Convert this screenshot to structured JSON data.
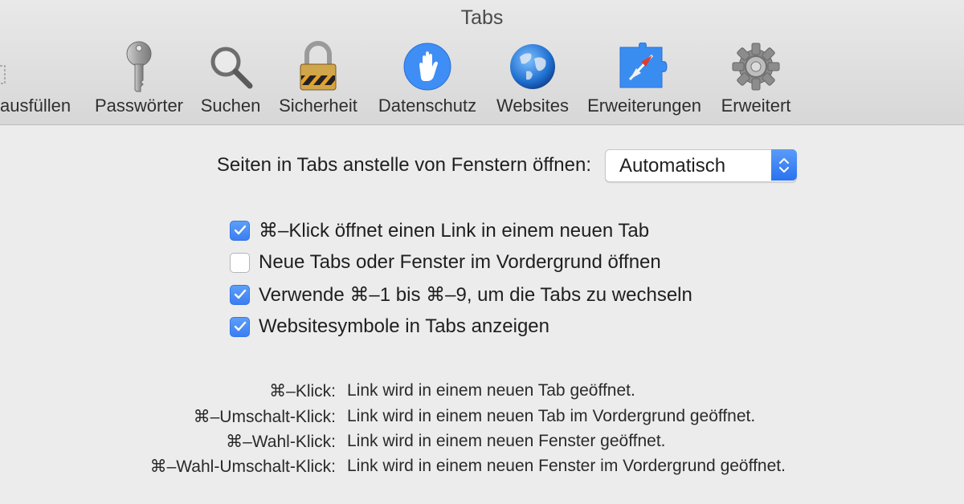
{
  "window": {
    "title": "Tabs"
  },
  "toolbar": {
    "items": [
      {
        "label": "ausfüllen",
        "icon": "autofill-icon"
      },
      {
        "label": "Passwörter",
        "icon": "key-icon"
      },
      {
        "label": "Suchen",
        "icon": "magnifier-icon"
      },
      {
        "label": "Sicherheit",
        "icon": "padlock-icon"
      },
      {
        "label": "Datenschutz",
        "icon": "hand-icon"
      },
      {
        "label": "Websites",
        "icon": "globe-icon"
      },
      {
        "label": "Erweiterungen",
        "icon": "puzzle-compass-icon"
      },
      {
        "label": "Erweitert",
        "icon": "gear-icon"
      }
    ]
  },
  "open_pages": {
    "label": "Seiten in Tabs anstelle von Fenstern öffnen:",
    "selected": "Automatisch"
  },
  "options": [
    {
      "label": "⌘–Klick öffnet einen Link in einem neuen Tab",
      "checked": true
    },
    {
      "label": "Neue Tabs oder Fenster im Vordergrund öffnen",
      "checked": false
    },
    {
      "label": "Verwende ⌘–1 bis ⌘–9, um die Tabs zu wechseln",
      "checked": true
    },
    {
      "label": "Websitesymbole in Tabs anzeigen",
      "checked": true
    }
  ],
  "shortcuts": [
    {
      "key": "⌘–Klick:",
      "desc": "Link wird in einem neuen Tab geöffnet."
    },
    {
      "key": "⌘–Umschalt-Klick:",
      "desc": "Link wird in einem neuen Tab im Vordergrund geöffnet."
    },
    {
      "key": "⌘–Wahl-Klick:",
      "desc": "Link wird in einem neuen Fenster geöffnet."
    },
    {
      "key": "⌘–Wahl-Umschalt-Klick:",
      "desc": "Link wird in einem neuen Fenster im Vordergrund geöffnet."
    }
  ],
  "colors": {
    "accent": "#3a7ef2",
    "toolbar_bg": "#dedede",
    "window_bg": "#ececec"
  }
}
